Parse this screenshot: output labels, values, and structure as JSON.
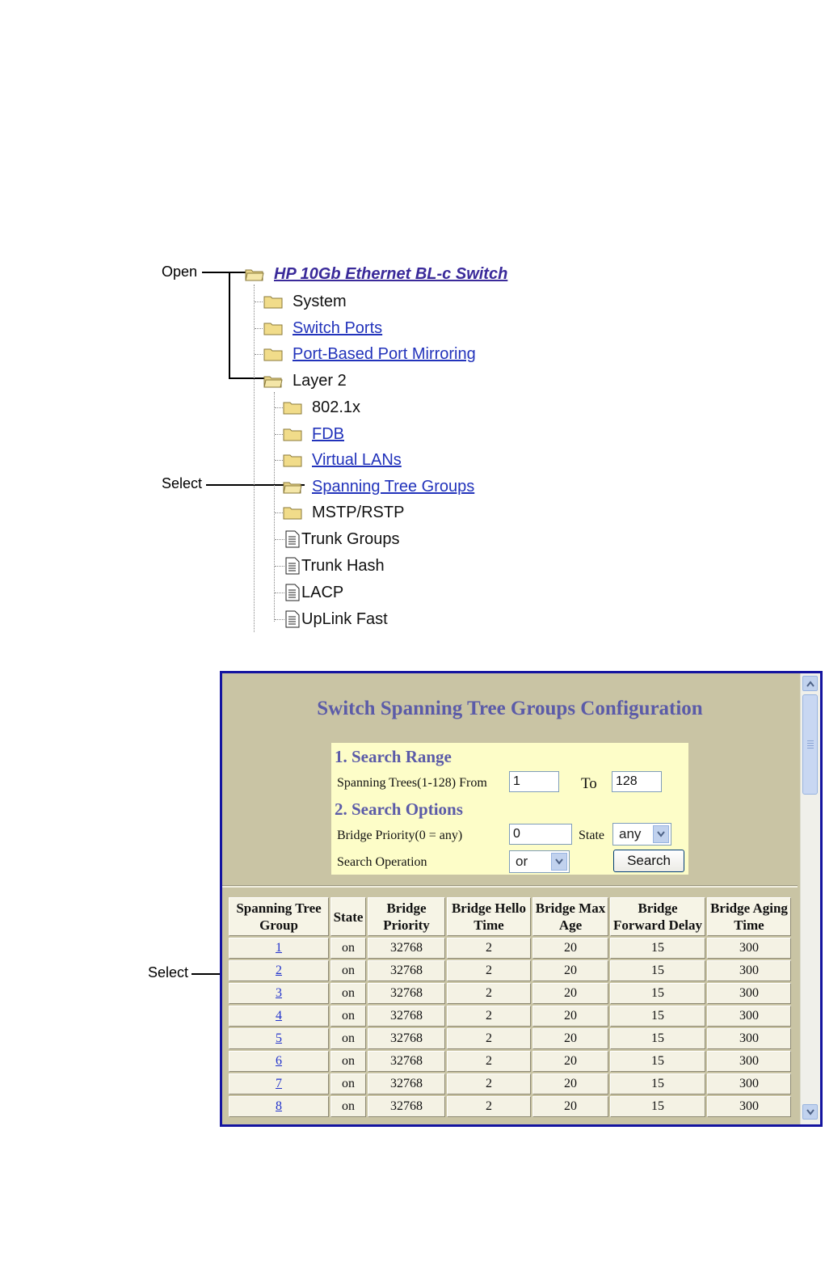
{
  "callouts": {
    "open": "Open",
    "select_tree": "Select",
    "select_table": "Select"
  },
  "tree": {
    "root": "HP 10Gb Ethernet BL-c Switch",
    "items": [
      {
        "label": "System",
        "icon": "folder-icon",
        "link": false
      },
      {
        "label": "Switch Ports",
        "icon": "folder-icon",
        "link": true
      },
      {
        "label": "Port-Based Port Mirroring",
        "icon": "folder-icon",
        "link": true
      },
      {
        "label": "Layer 2",
        "icon": "open-folder-icon",
        "link": false
      }
    ],
    "layer2_items": [
      {
        "label": "802.1x",
        "icon": "folder-icon",
        "link": false
      },
      {
        "label": "FDB",
        "icon": "folder-icon",
        "link": true
      },
      {
        "label": "Virtual LANs",
        "icon": "folder-icon",
        "link": true
      },
      {
        "label": "Spanning Tree Groups",
        "icon": "open-folder-icon",
        "link": true
      },
      {
        "label": "MSTP/RSTP",
        "icon": "folder-icon",
        "link": false
      },
      {
        "label": "Trunk Groups",
        "icon": "document-icon",
        "link": false
      },
      {
        "label": "Trunk Hash",
        "icon": "document-icon",
        "link": false
      },
      {
        "label": "LACP",
        "icon": "document-icon",
        "link": false
      },
      {
        "label": "UpLink Fast",
        "icon": "document-icon",
        "link": false
      }
    ]
  },
  "panel": {
    "title": "Switch Spanning Tree Groups Configuration",
    "search_range": {
      "heading": "1. Search Range",
      "label": "Spanning Trees(1-128) From",
      "from_value": "1",
      "to_label": "To",
      "to_value": "128"
    },
    "search_options": {
      "heading": "2. Search Options",
      "priority_label": "Bridge Priority(0 = any)",
      "priority_value": "0",
      "state_label": "State",
      "state_value": "any",
      "operation_label": "Search Operation",
      "operation_value": "or",
      "search_button": "Search"
    },
    "table": {
      "headers": [
        "Spanning Tree Group",
        "State",
        "Bridge Priority",
        "Bridge Hello Time",
        "Bridge Max Age",
        "Bridge Forward Delay",
        "Bridge Aging Time"
      ],
      "rows": [
        [
          "1",
          "on",
          "32768",
          "2",
          "20",
          "15",
          "300"
        ],
        [
          "2",
          "on",
          "32768",
          "2",
          "20",
          "15",
          "300"
        ],
        [
          "3",
          "on",
          "32768",
          "2",
          "20",
          "15",
          "300"
        ],
        [
          "4",
          "on",
          "32768",
          "2",
          "20",
          "15",
          "300"
        ],
        [
          "5",
          "on",
          "32768",
          "2",
          "20",
          "15",
          "300"
        ],
        [
          "6",
          "on",
          "32768",
          "2",
          "20",
          "15",
          "300"
        ],
        [
          "7",
          "on",
          "32768",
          "2",
          "20",
          "15",
          "300"
        ],
        [
          "8",
          "on",
          "32768",
          "2",
          "20",
          "15",
          "300"
        ]
      ]
    }
  }
}
